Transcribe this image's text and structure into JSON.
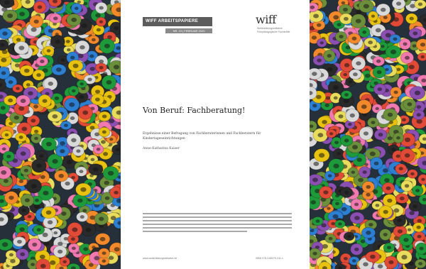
{
  "cover": {
    "series_label": "WIFF ARBEITSPAPIERE",
    "series_number": "NR. 19 | FEBRUAR 2020",
    "logo_text": "wiff",
    "logo_subtitle": "Weiterbildungsinitiative Frühpädagogische Fachkräfte",
    "title": "Von Beruf: Fachberatung!",
    "subtitle": "Ergebnisse einer Befragung von Fachberaterinnen und Fachberatern für Kindertageseinrichtungen",
    "author": "Anne-Katharina Kaiser",
    "footer_url": "www.weiterbildungsinitiative.de",
    "footer_isbn": "ISBN 978-3-86379-311-1"
  },
  "colors": {
    "series_bar": "#5c5c5c",
    "bead_palette": [
      "#e8c20f",
      "#1f9a3a",
      "#e9dc5a",
      "#e04a36",
      "#8a4fb0",
      "#d9d9d9",
      "#f07ab0",
      "#2d7fd1",
      "#f28a2b",
      "#2a2a2a",
      "#6b8f3a"
    ]
  }
}
